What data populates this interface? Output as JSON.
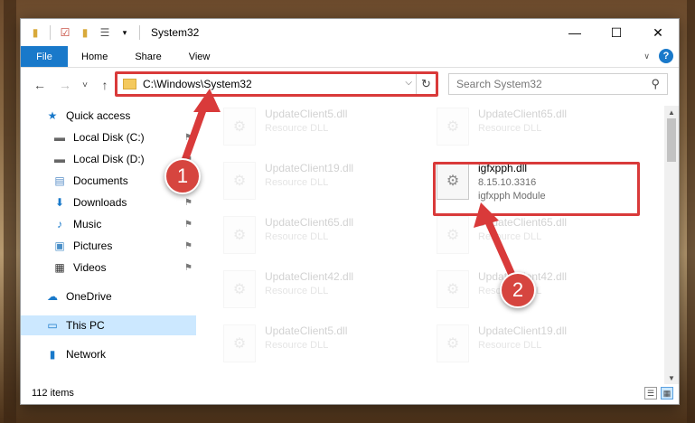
{
  "window": {
    "title": "System32",
    "controls": {
      "minimize": "—",
      "maximize": "☐",
      "close": "✕"
    }
  },
  "ribbon": {
    "tabs": [
      "File",
      "Home",
      "Share",
      "View"
    ],
    "help": "?"
  },
  "nav": {
    "back": "←",
    "forward": "→",
    "recent": "˅",
    "up": "↑",
    "address": "C:\\Windows\\System32",
    "refresh": "↻",
    "search_placeholder": "Search System32",
    "search_icon": "search-icon"
  },
  "sidebar": {
    "items": [
      {
        "label": "Quick access",
        "icon": "star-icon",
        "glyph": "★",
        "color": "#1979ca",
        "pinned": false
      },
      {
        "label": "Local Disk (C:)",
        "icon": "drive-icon",
        "glyph": "▬",
        "color": "#666666",
        "pinned": true
      },
      {
        "label": "Local Disk (D:)",
        "icon": "drive-icon",
        "glyph": "▬",
        "color": "#666666",
        "pinned": true
      },
      {
        "label": "Documents",
        "icon": "document-icon",
        "glyph": "▤",
        "color": "#5a8fc8",
        "pinned": true
      },
      {
        "label": "Downloads",
        "icon": "download-icon",
        "glyph": "⬇",
        "color": "#1979ca",
        "pinned": true
      },
      {
        "label": "Music",
        "icon": "music-icon",
        "glyph": "♪",
        "color": "#1979ca",
        "pinned": true
      },
      {
        "label": "Pictures",
        "icon": "picture-icon",
        "glyph": "▣",
        "color": "#4a8fc8",
        "pinned": true
      },
      {
        "label": "Videos",
        "icon": "video-icon",
        "glyph": "▦",
        "color": "#333333",
        "pinned": true
      },
      {
        "label": "OneDrive",
        "icon": "cloud-icon",
        "glyph": "☁",
        "color": "#1979ca",
        "pinned": false
      },
      {
        "label": "This PC",
        "icon": "computer-icon",
        "glyph": "▭",
        "color": "#1979ca",
        "pinned": false
      },
      {
        "label": "Network",
        "icon": "network-icon",
        "glyph": "▮",
        "color": "#1979ca",
        "pinned": false
      }
    ]
  },
  "files": [
    {
      "name": "UpdateClient5.dll",
      "sub": "Resource DLL",
      "faded": true
    },
    {
      "name": "UpdateClient65.dll",
      "sub": "Resource DLL",
      "faded": true
    },
    {
      "name": "UpdateClient19.dll",
      "sub": "Resource DLL",
      "faded": true
    },
    {
      "name": "igfxpph.dll",
      "sub": "8.15.10.3316",
      "sub2": "igfxpph Module",
      "faded": false
    },
    {
      "name": "UpdateClient65.dll",
      "sub": "Resource DLL",
      "faded": true
    },
    {
      "name": "UpdateClient65.dll",
      "sub": "Resource DLL",
      "faded": true
    },
    {
      "name": "UpdateClient42.dll",
      "sub": "Resource DLL",
      "faded": true
    },
    {
      "name": "UpdateClient42.dll",
      "sub": "Resource DLL",
      "faded": true
    },
    {
      "name": "UpdateClient5.dll",
      "sub": "Resource DLL",
      "faded": true
    },
    {
      "name": "UpdateClient19.dll",
      "sub": "Resource DLL",
      "faded": true
    }
  ],
  "status": {
    "item_count": "112 items"
  },
  "annotations": {
    "marker1": "1",
    "marker2": "2",
    "color": "#d93a3a"
  }
}
